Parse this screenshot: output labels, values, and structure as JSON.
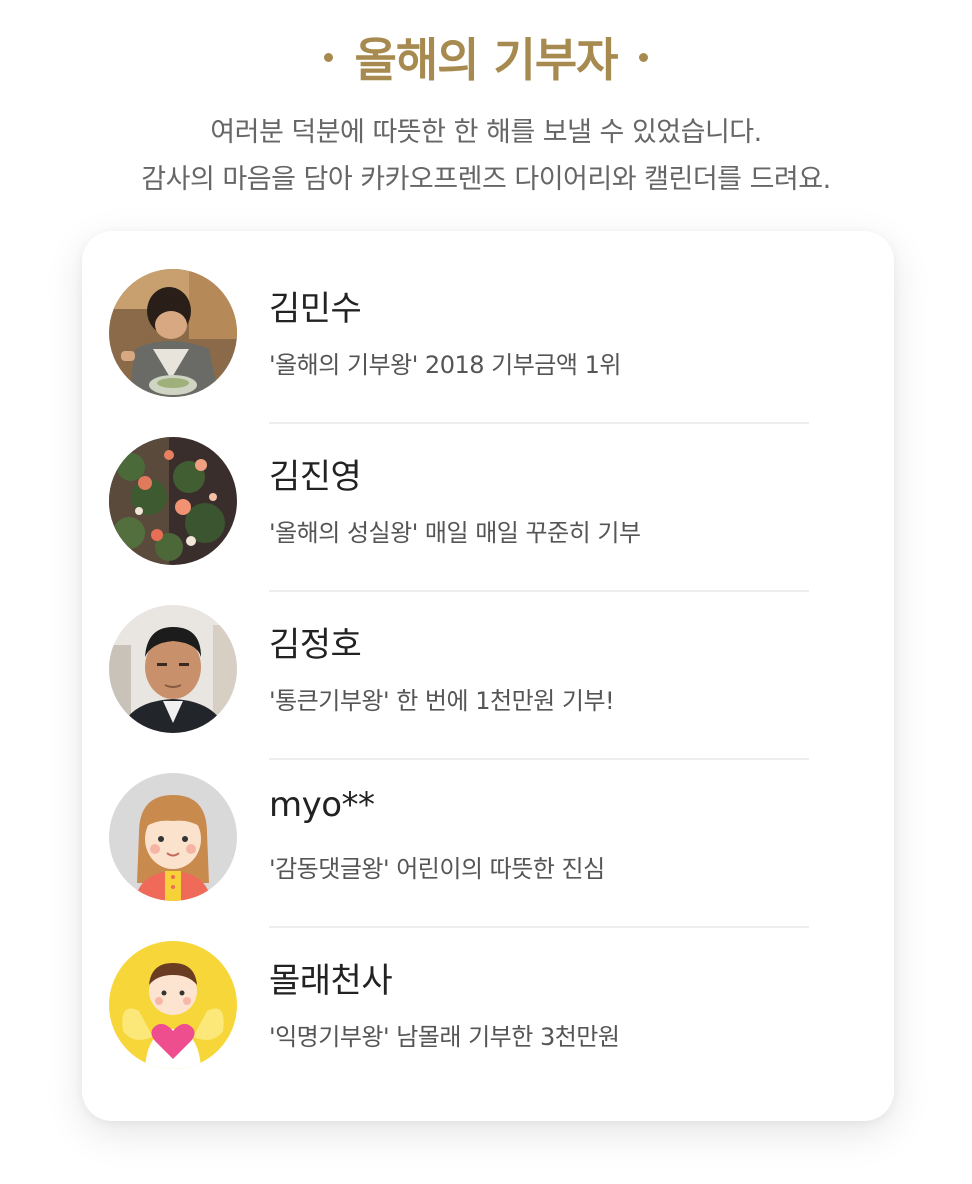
{
  "header": {
    "title": "올해의 기부자",
    "subtitle_line1": "여러분 덕분에 따뜻한 한 해를 보낼 수 있었습니다.",
    "subtitle_line2": "감사의 마음을 담아 카카오프렌즈 다이어리와 캘린더를 드려요."
  },
  "donors": [
    {
      "name": "김민수",
      "desc": "'올해의 기부왕' 2018 기부금액 1위",
      "avatar": "photo-man-eating"
    },
    {
      "name": "김진영",
      "desc": "'올해의 성실왕' 매일 매일 꾸준히 기부",
      "avatar": "photo-flowers"
    },
    {
      "name": "김정호",
      "desc": "'통큰기부왕' 한 번에 1천만원 기부!",
      "avatar": "photo-man-portrait"
    },
    {
      "name": "myo**",
      "desc": "'감동댓글왕' 어린이의 따뜻한 진심",
      "avatar": "illustration-girl"
    },
    {
      "name": "몰래천사",
      "desc": "'익명기부왕' 남몰래 기부한 3천만원",
      "avatar": "illustration-angel-heart"
    }
  ],
  "colors": {
    "accent": "#a78a4f",
    "angel_bg": "#f7d63a",
    "heart": "#ee4d8e"
  }
}
